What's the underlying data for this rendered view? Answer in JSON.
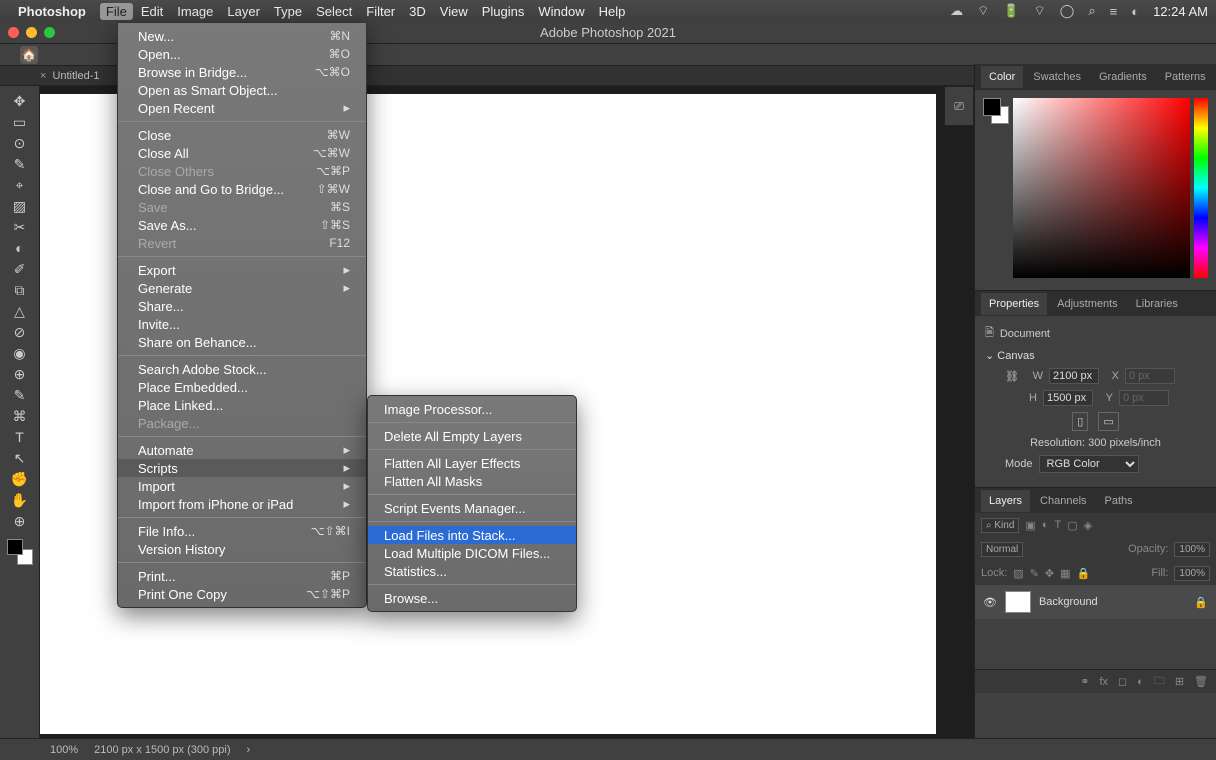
{
  "menubar": {
    "app": "Photoshop",
    "items": [
      "File",
      "Edit",
      "Image",
      "Layer",
      "Type",
      "Select",
      "Filter",
      "3D",
      "View",
      "Plugins",
      "Window",
      "Help"
    ],
    "open_index": 0,
    "clock": "12:24 AM"
  },
  "window": {
    "title": "Adobe Photoshop 2021"
  },
  "tab": {
    "close": "×",
    "name": "Untitled-1"
  },
  "status": {
    "zoom": "100%",
    "dims": "2100 px x 1500 px (300 ppi)",
    "chev": "›"
  },
  "file_menu": [
    {
      "t": "New...",
      "sc": "⌘N"
    },
    {
      "t": "Open...",
      "sc": "⌘O"
    },
    {
      "t": "Browse in Bridge...",
      "sc": "⌥⌘O"
    },
    {
      "t": "Open as Smart Object..."
    },
    {
      "t": "Open Recent",
      "sub": true
    },
    {
      "sep": true
    },
    {
      "t": "Close",
      "sc": "⌘W"
    },
    {
      "t": "Close All",
      "sc": "⌥⌘W"
    },
    {
      "t": "Close Others",
      "sc": "⌥⌘P",
      "dis": true
    },
    {
      "t": "Close and Go to Bridge...",
      "sc": "⇧⌘W"
    },
    {
      "t": "Save",
      "sc": "⌘S",
      "dis": true
    },
    {
      "t": "Save As...",
      "sc": "⇧⌘S"
    },
    {
      "t": "Revert",
      "sc": "F12",
      "dis": true
    },
    {
      "sep": true
    },
    {
      "t": "Export",
      "sub": true
    },
    {
      "t": "Generate",
      "sub": true
    },
    {
      "t": "Share..."
    },
    {
      "t": "Invite..."
    },
    {
      "t": "Share on Behance..."
    },
    {
      "sep": true
    },
    {
      "t": "Search Adobe Stock..."
    },
    {
      "t": "Place Embedded..."
    },
    {
      "t": "Place Linked..."
    },
    {
      "t": "Package...",
      "dis": true
    },
    {
      "sep": true
    },
    {
      "t": "Automate",
      "sub": true
    },
    {
      "t": "Scripts",
      "sub": true,
      "hov": true
    },
    {
      "t": "Import",
      "sub": true
    },
    {
      "t": "Import from iPhone or iPad",
      "sub": true
    },
    {
      "sep": true
    },
    {
      "t": "File Info...",
      "sc": "⌥⇧⌘I"
    },
    {
      "t": "Version History"
    },
    {
      "sep": true
    },
    {
      "t": "Print...",
      "sc": "⌘P"
    },
    {
      "t": "Print One Copy",
      "sc": "⌥⇧⌘P"
    }
  ],
  "scripts_menu": [
    {
      "t": "Image Processor..."
    },
    {
      "sep": true
    },
    {
      "t": "Delete All Empty Layers"
    },
    {
      "sep": true
    },
    {
      "t": "Flatten All Layer Effects"
    },
    {
      "t": "Flatten All Masks"
    },
    {
      "sep": true
    },
    {
      "t": "Script Events Manager..."
    },
    {
      "sep": true
    },
    {
      "t": "Load Files into Stack...",
      "hl": true
    },
    {
      "t": "Load Multiple DICOM Files..."
    },
    {
      "t": "Statistics..."
    },
    {
      "sep": true
    },
    {
      "t": "Browse..."
    }
  ],
  "rpanel": {
    "color_tabs": [
      "Color",
      "Swatches",
      "Gradients",
      "Patterns"
    ],
    "prop_tabs": [
      "Properties",
      "Adjustments",
      "Libraries"
    ],
    "layer_tabs": [
      "Layers",
      "Channels",
      "Paths"
    ],
    "doc_label": "Document",
    "canvas_hdr": "Canvas",
    "W": "W",
    "wval": "2100 px",
    "X": "X",
    "xval": "0 px",
    "H": "H",
    "hval": "1500 px",
    "Y": "Y",
    "yval": "0 px",
    "res": "Resolution: 300 pixels/inch",
    "mode_lbl": "Mode",
    "mode": "RGB Color",
    "kind": "Kind",
    "blend": "Normal",
    "opacity_lbl": "Opacity:",
    "opacity": "100%",
    "lock_lbl": "Lock:",
    "fill_lbl": "Fill:",
    "fill": "100%",
    "layer_name": "Background"
  },
  "tools": [
    "✥",
    "▭",
    "⊙",
    "✎",
    "⌖",
    "▨",
    "✂",
    "◐",
    "✐",
    "⧉",
    "△",
    "⊘",
    "◉",
    "⊕",
    "✎",
    "⌘",
    "T",
    "↖",
    "✊",
    "✋",
    "⊕"
  ]
}
